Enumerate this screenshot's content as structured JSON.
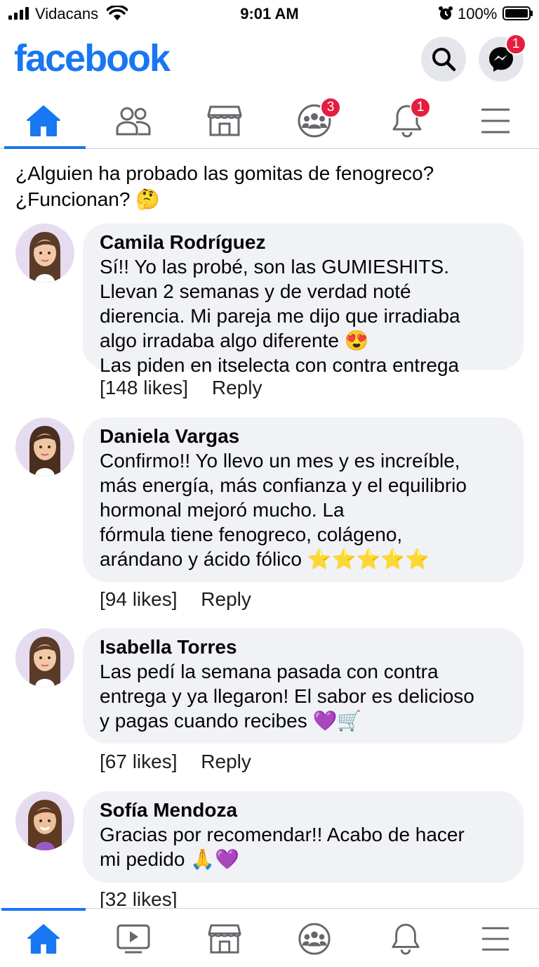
{
  "status_bar": {
    "carrier": "Vidacans",
    "time": "9:01 AM",
    "battery": "100%"
  },
  "header": {
    "logo": "facebook",
    "messenger_badge": "1"
  },
  "top_nav": {
    "groups_badge": "3",
    "notifications_badge": "1"
  },
  "post": {
    "text": "¿Alguien ha probado las gomitas de fenogreco? ¿Funcionan? 🤔"
  },
  "comments": [
    {
      "name": "Camila Rodríguez",
      "lines": [
        "Sí!! Yo las probé, son las GUMIESHITS.",
        "Llevan 2 semanas y de verdad noté",
        "dierencia. Mi pareja me dijo que irradiaba",
        "algo irradaba algo diferente 😍",
        "Las piden en itselecta con contra entrega"
      ],
      "likes": "[148 likes]",
      "reply": "Reply"
    },
    {
      "name": "Daniela Vargas",
      "lines": [
        "Confirmo!! Yo llevo un mes y es increíble,",
        "más energía, más confianza y el equilibrio",
        "hormonal mejoró mucho. La",
        "fórmula tiene fenogreco, colágeno,",
        "arándano y ácido fólico ⭐⭐⭐⭐⭐"
      ],
      "likes": "[94 likes]",
      "reply": "Reply"
    },
    {
      "name": "Isabella Torres",
      "lines": [
        "Las pedí la semana pasada con contra",
        "entrega y ya llegaron! El sabor es delicioso",
        "y pagas cuando recibes 💜🛒"
      ],
      "likes": "[67 likes]",
      "reply": "Reply"
    },
    {
      "name": "Sofía Mendoza",
      "lines": [
        "Gracias por recomendar!! Acabo de hacer",
        "mi pedido 🙏💜"
      ],
      "likes": "[32 likes]"
    }
  ],
  "colors": {
    "brand": "#1877f2",
    "badge": "#e41e3f",
    "bubble": "#f0f2f5",
    "icon": "#65676b"
  }
}
